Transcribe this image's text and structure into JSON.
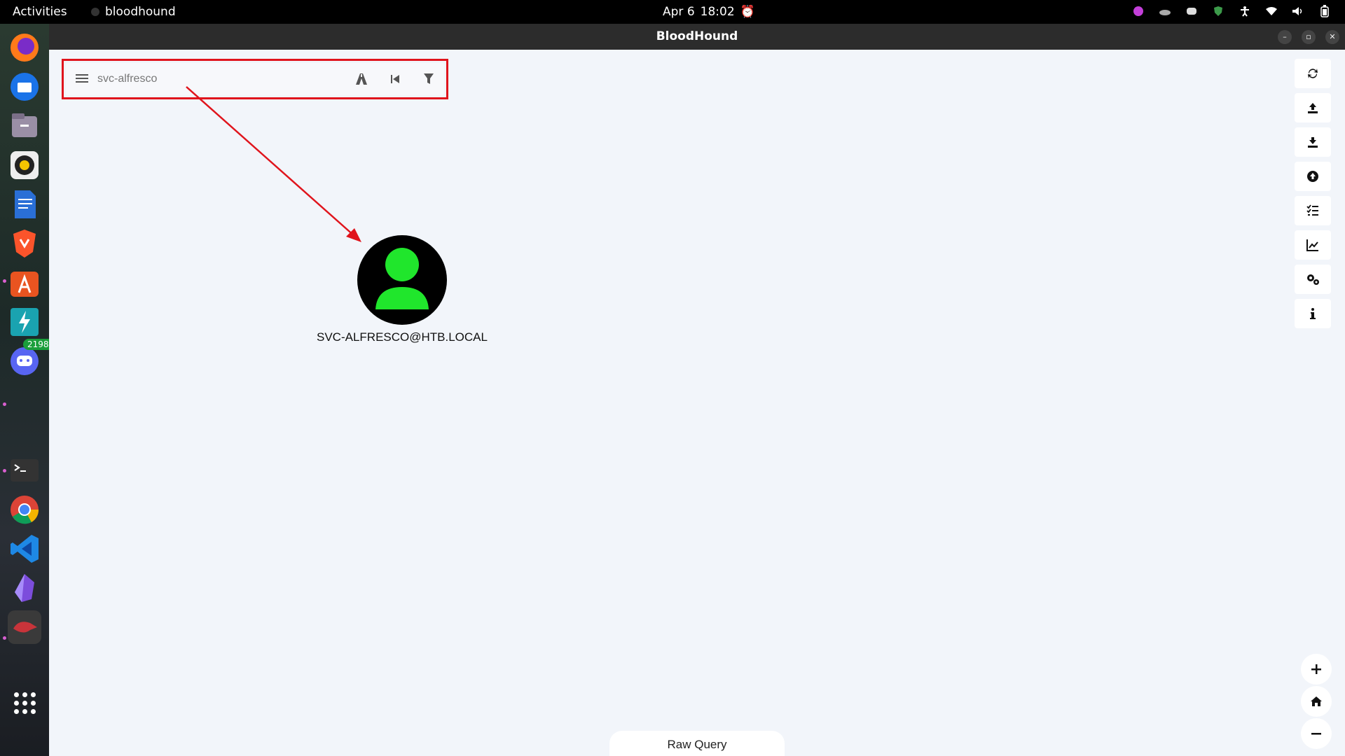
{
  "topbar": {
    "activities": "Activities",
    "app_name": "bloodhound",
    "date": "Apr 6",
    "time": "18:02"
  },
  "dock": {
    "discord_badge": "2198"
  },
  "window": {
    "title": "BloodHound"
  },
  "search": {
    "value": "svc-alfresco"
  },
  "graph": {
    "node_label": "SVC-ALFRESCO@HTB.LOCAL"
  },
  "raw_query": {
    "label": "Raw Query"
  },
  "colors": {
    "highlight": "#e0141c",
    "user_node": "#20e62c"
  }
}
